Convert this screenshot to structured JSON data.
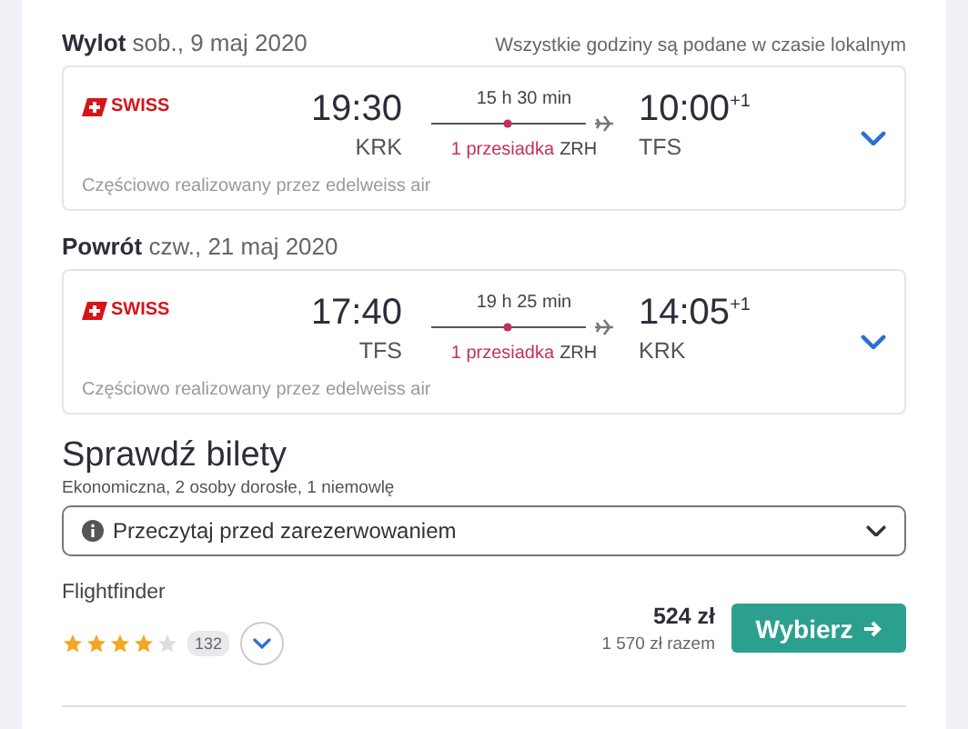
{
  "legs": [
    {
      "label": "Wylot",
      "date": "sob., 9 maj 2020",
      "note": "Wszystkie godziny są podane w czasie lokalnym",
      "airline": "SWISS",
      "depart_time": "19:30",
      "depart_airport": "KRK",
      "duration": "15 h 30 min",
      "stops": "1 przesiadka",
      "stop_airport": "ZRH",
      "arrive_time": "10:00",
      "day_offset": "+1",
      "arrive_airport": "TFS",
      "operator": "Częściowo realizowany przez edelweiss air"
    },
    {
      "label": "Powrót",
      "date": "czw., 21 maj 2020",
      "airline": "SWISS",
      "depart_time": "17:40",
      "depart_airport": "TFS",
      "duration": "19 h 25 min",
      "stops": "1 przesiadka",
      "stop_airport": "ZRH",
      "arrive_time": "14:05",
      "day_offset": "+1",
      "arrive_airport": "KRK",
      "operator": "Częściowo realizowany przez edelweiss air"
    }
  ],
  "tickets": {
    "title": "Sprawdź bilety",
    "subtitle": "Ekonomiczna, 2 osoby dorosłe, 1 niemowlę",
    "notice": "Przeczytaj przed zarezerwowaniem",
    "provider": "Flightfinder",
    "stars": 4,
    "reviews": "132",
    "price": "524 zł",
    "total": "1 570 zł razem",
    "button": "Wybierz"
  }
}
